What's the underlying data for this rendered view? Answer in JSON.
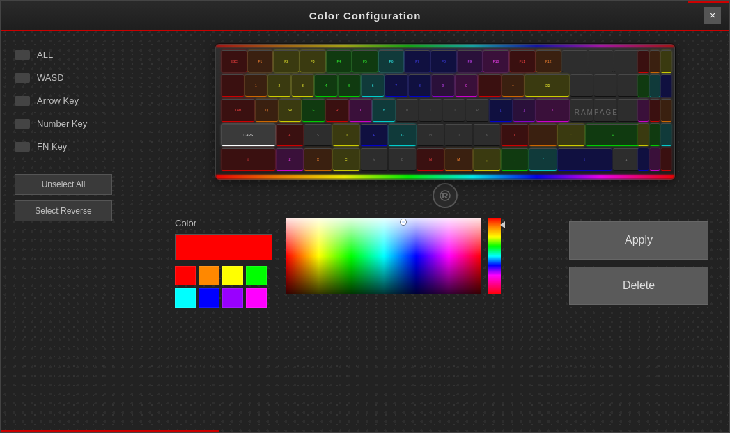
{
  "window": {
    "title": "Color Configuration",
    "close_label": "×"
  },
  "sidebar": {
    "items": [
      {
        "id": "all",
        "label": "ALL"
      },
      {
        "id": "wasd",
        "label": "WASD"
      },
      {
        "id": "arrow",
        "label": "Arrow Key"
      },
      {
        "id": "number",
        "label": "Number Key"
      },
      {
        "id": "fn",
        "label": "FN Key"
      }
    ],
    "unselect_all": "Unselect All",
    "select_reverse": "Select Reverse"
  },
  "color_section": {
    "label": "Color",
    "apply_btn": "Apply",
    "delete_btn": "Delete"
  },
  "swatches": {
    "row1": [
      "#ff0000",
      "#ff8800",
      "#ffff00",
      "#00ff00"
    ],
    "row2": [
      "#00ffff",
      "#0000ff",
      "#9900ff",
      "#ff00ff"
    ]
  }
}
